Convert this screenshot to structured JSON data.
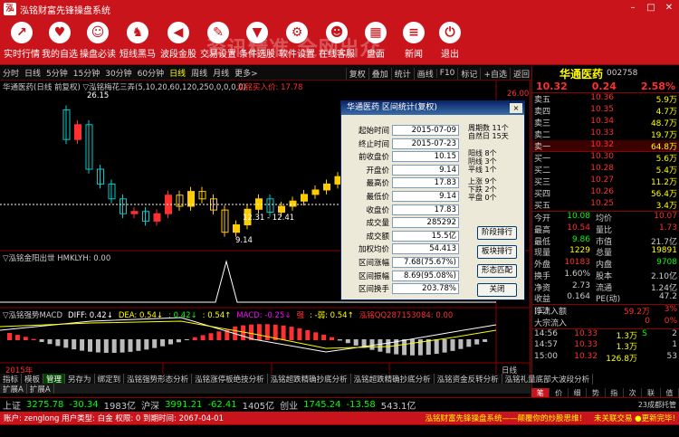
{
  "window": {
    "title": "泓铭财富先锋操盘系统"
  },
  "toolbar": {
    "buttons": [
      {
        "label": "实时行情",
        "icon": "line-chart-icon"
      },
      {
        "label": "我的自选",
        "icon": "heart-icon"
      },
      {
        "label": "操盘必读",
        "icon": "people-icon"
      },
      {
        "label": "短线黑马",
        "icon": "horse-icon"
      },
      {
        "label": "波段金股",
        "icon": "speaker-icon"
      },
      {
        "label": "交易设置",
        "icon": "pen-icon"
      },
      {
        "label": "条件选股",
        "icon": "filter-icon"
      },
      {
        "label": "软件设置",
        "icon": "gear-icon"
      },
      {
        "label": "在线客服",
        "icon": "users-icon"
      },
      {
        "label": "盘面",
        "icon": "building-icon"
      },
      {
        "label": "新闻",
        "icon": "news-icon"
      },
      {
        "label": "退出",
        "icon": "exit-icon"
      }
    ],
    "watermark": "资讯精准 全网出众"
  },
  "periods": [
    "分时",
    "日线",
    "5分钟",
    "15分钟",
    "30分钟",
    "60分钟",
    "日线",
    "周线",
    "月线",
    "更多>"
  ],
  "tools": [
    "复权",
    "叠加",
    "统计",
    "画线",
    "F10",
    "标记",
    "+自选",
    "返回"
  ],
  "main_chart": {
    "legend": "华通医药(日线 前复权) ▽泓铭梅花三弄(5,10,20,60,120,250,0,0,0,0)",
    "buy_label": "泓铭买入价: 17.78",
    "hi_label": "26.15",
    "lo_label": "9.14",
    "range_label": "12.31 - 12.41",
    "axis_top": "26.00"
  },
  "sub1": {
    "legend": "▽泓铭金阳出世 HMKLYH: 0.00"
  },
  "sub2": {
    "name": "▽泓铭强势MACD",
    "items": [
      {
        "t": "DIFF: 0.42↓",
        "c": "#ffffff"
      },
      {
        "t": "DEA: 0.54↓",
        "c": "#ffff00"
      },
      {
        "t": ": 0.42↓",
        "c": "#00ff00"
      },
      {
        "t": ": 0.54↑",
        "c": "#ffff00"
      },
      {
        "t": "MACD: -0.25↓",
        "c": "#ff00ff"
      },
      {
        "t": "强",
        "c": "#ff3030"
      },
      {
        "t": ": -弱: 0.54↑",
        "c": "#ffff00"
      },
      {
        "t": "泓铭QQ287153084: 0.00",
        "c": "#ff3030"
      }
    ]
  },
  "axis": {
    "year": "2015年",
    "date_labels": [
      "6",
      "7",
      "8"
    ],
    "date_label_right": "日线"
  },
  "tabs": [
    "指标",
    "模板",
    "管理",
    "另存为",
    "绑定到",
    "泓铭强势形态分析",
    "泓铭涨停板绝技分析",
    "泓铭超跌精确抄底分析",
    "泓铭超跌精确抄底分析",
    "泓铭资金反转分析",
    "泓铭礼量底部大波段分析"
  ],
  "ktabs": [
    "扩展A",
    "扩展A"
  ],
  "dialog": {
    "title": "华通医药 区间统计(复权)",
    "close": "×",
    "fields": [
      {
        "label": "起始时间",
        "value": "2015-07-09"
      },
      {
        "label": "终止时间",
        "value": "2015-07-23"
      },
      {
        "label": "前收盘价",
        "value": "10.15"
      },
      {
        "label": "开盘价",
        "value": "9.14"
      },
      {
        "label": "最高价",
        "value": "17.83"
      },
      {
        "label": "最低价",
        "value": "9.14"
      },
      {
        "label": "收盘价",
        "value": "17.83"
      },
      {
        "label": "成交量",
        "value": "285292"
      },
      {
        "label": "成交额",
        "value": "15.5亿"
      },
      {
        "label": "加权均价",
        "value": "54.413"
      },
      {
        "label": "区间涨幅",
        "value": "7.68(75.67%)"
      },
      {
        "label": "区间振幅",
        "value": "8.69(95.08%)"
      },
      {
        "label": "区间换手",
        "value": "203.78%"
      }
    ],
    "period": [
      "周期数 11个",
      "自然日 15天"
    ],
    "counts": [
      "阳线 8个",
      "阴线 3个",
      "平线 1个"
    ],
    "updown": [
      "上涨 9个",
      "下跌 2个",
      "平盘 0个"
    ],
    "buttons": [
      "阶段排行",
      "板块排行",
      "形态匹配",
      "关闭"
    ]
  },
  "quote": {
    "name": "华通医药",
    "code": "002758",
    "price": "10.32",
    "change": "0.24",
    "pct": "2.58%",
    "asks": [
      {
        "l": "卖五",
        "p": "10.36",
        "v": "5.9万"
      },
      {
        "l": "卖四",
        "p": "10.35",
        "v": "4.7万"
      },
      {
        "l": "卖三",
        "p": "10.34",
        "v": "48.7万"
      },
      {
        "l": "卖二",
        "p": "10.33",
        "v": "19.7万"
      },
      {
        "l": "卖一",
        "p": "10.32",
        "v": "64.8万"
      }
    ],
    "bids": [
      {
        "l": "买一",
        "p": "10.30",
        "v": "5.6万"
      },
      {
        "l": "买二",
        "p": "10.28",
        "v": "5.4万"
      },
      {
        "l": "买三",
        "p": "10.27",
        "v": "11.2万"
      },
      {
        "l": "买四",
        "p": "10.26",
        "v": "56.4万"
      },
      {
        "l": "买五",
        "p": "10.25",
        "v": "3.4万"
      }
    ],
    "stats": [
      {
        "a": "今开",
        "b": "10.08",
        "bc": "#00ff00",
        "c": "均价",
        "d": "10.07",
        "dc": "#ff3030"
      },
      {
        "a": "最高",
        "b": "10.54",
        "bc": "#ff3030",
        "c": "量比",
        "d": "1.73",
        "dc": "#ff3030"
      },
      {
        "a": "最低",
        "b": "9.86",
        "bc": "#00ff00",
        "c": "市值",
        "d": "21.7亿",
        "dc": "#ccc"
      },
      {
        "a": "现量",
        "b": "1229",
        "bc": "#ffff00",
        "c": "总量",
        "d": "19891",
        "dc": "#ffff00"
      },
      {
        "a": "外盘",
        "b": "10183",
        "bc": "#ff3030",
        "c": "内盘",
        "d": "9708",
        "dc": "#00ff00"
      },
      {
        "a": "换手",
        "b": "1.60%",
        "bc": "#ccc",
        "c": "股本",
        "d": "2.10亿",
        "dc": "#ccc"
      },
      {
        "a": "净资",
        "b": "2.73",
        "bc": "#ccc",
        "c": "流通",
        "d": "1.24亿",
        "dc": "#ccc"
      },
      {
        "a": "收益(二)",
        "b": "0.164",
        "bc": "#ccc",
        "c": "PE(动)",
        "d": "47.2",
        "dc": "#ccc"
      }
    ],
    "flow": [
      {
        "a": "净流入额",
        "b": "59.2万",
        "c": "3%"
      },
      {
        "a": "大宗流入",
        "b": "0",
        "c": "0%"
      }
    ],
    "ticks": [
      {
        "t": "14:56",
        "p": "10.33",
        "v": "1.3万",
        "s": "S",
        "n": "2"
      },
      {
        "t": "14:57",
        "p": "10.33",
        "v": "1.3万",
        "s": "",
        "n": "1"
      },
      {
        "t": "15:00",
        "p": "10.32",
        "v": "126.8万",
        "s": "",
        "n": "53"
      }
    ],
    "rtabs": [
      "笔",
      "价",
      "细",
      "势",
      "指",
      "次",
      "联",
      "值"
    ]
  },
  "indices": [
    {
      "name": "上证",
      "val": "3275.78",
      "chg": "-30.34",
      "amt": "1983亿"
    },
    {
      "name": "沪深",
      "val": "3991.21",
      "chg": "-62.41",
      "amt": "1405亿"
    },
    {
      "name": "创业",
      "val": "1745.24",
      "chg": "-13.58",
      "amt": "543.1亿"
    }
  ],
  "index_tail": "23成都托管",
  "status": {
    "user": "账户: zenglong 用户类型: 白金 权限: 0 到期时间: 2067-04-01",
    "right": "泓铭财富先锋操盘系统——颠覆你的炒股思维！",
    "link": "未关联交易 ●更新完毕!"
  }
}
